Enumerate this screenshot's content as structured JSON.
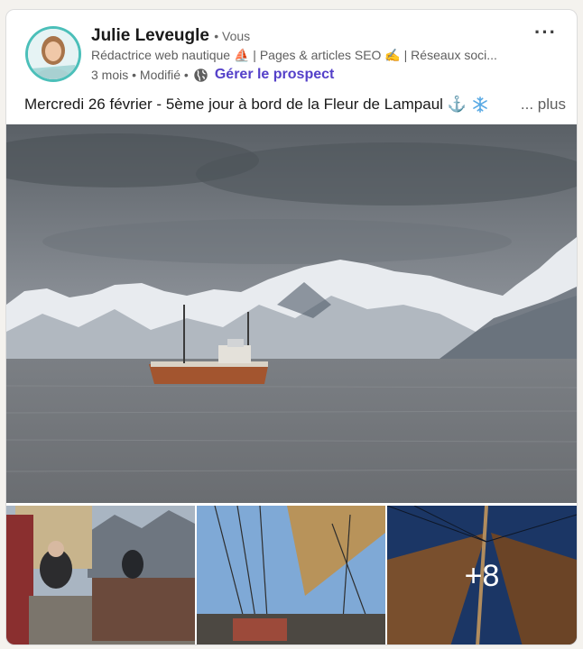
{
  "post": {
    "author_name": "Julie Leveugle",
    "you_tag": "• Vous",
    "headline": "Rédactrice web nautique ⛵ | Pages & articles SEO ✍ | Réseaux soci...",
    "time": "3 mois • Modifié •",
    "manage_prospect": "Gérer le prospect",
    "more_menu": "···",
    "text": "Mercredi 26 février - 5ème jour à bord de la Fleur de Lampaul ⚓",
    "see_more": "... plus",
    "extra_photos_count": "+8"
  },
  "icons": {
    "avatar": "profile-photo",
    "globe": "globe-icon",
    "snowflake": "snowflake-icon",
    "menu": "ellipsis-icon"
  },
  "colors": {
    "avatar_ring": "#4bbfb9",
    "link": "#5440c9"
  }
}
